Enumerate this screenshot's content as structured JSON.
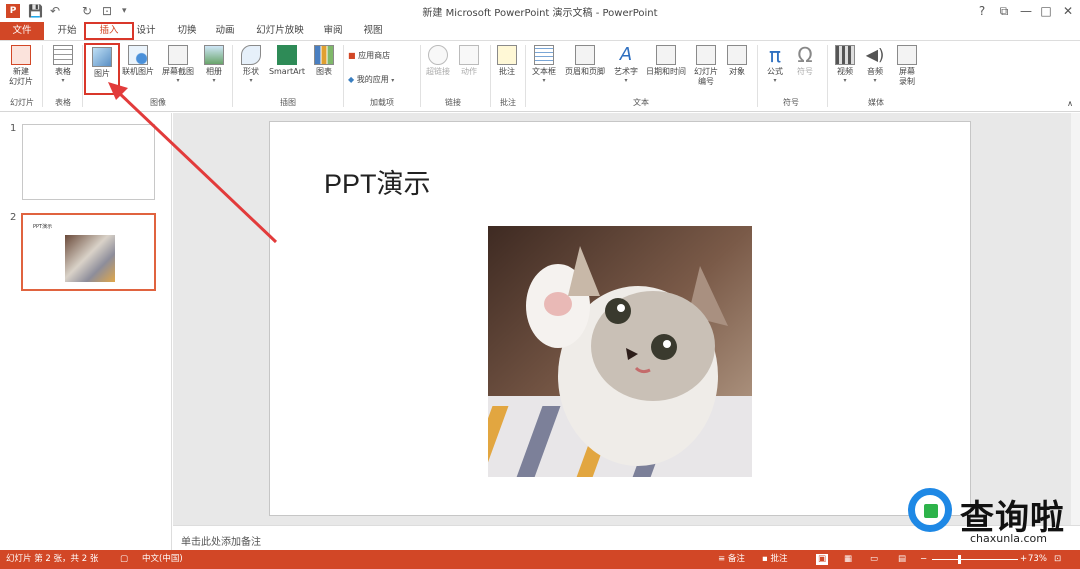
{
  "titlebar": {
    "logo": "P",
    "title": "新建 Microsoft PowerPoint 演示文稿 - PowerPoint",
    "help": "?",
    "restore": "⧉",
    "minimize": "—",
    "maximize": "□",
    "close": "✕"
  },
  "quick_access": {
    "save": "💾",
    "undo": "↶",
    "redo": "↻",
    "start": "⊡",
    "more": "▾"
  },
  "tabs": [
    "文件",
    "开始",
    "插入",
    "设计",
    "切换",
    "动画",
    "幻灯片放映",
    "审阅",
    "视图"
  ],
  "ribbon": {
    "new_slide": "新建\n幻灯片",
    "table": "表格",
    "picture": "图片",
    "online_picture": "联机图片",
    "screenshot": "屏幕截图",
    "album": "相册",
    "shapes": "形状",
    "smartart": "SmartArt",
    "chart": "图表",
    "store": "应用商店",
    "my_apps": "我的应用",
    "hyperlink": "超链接",
    "action": "动作",
    "comment": "批注",
    "textbox": "文本框",
    "header_footer": "页眉和页脚",
    "wordart": "艺术字",
    "datetime": "日期和时间",
    "slide_number": "幻灯片\n编号",
    "object": "对象",
    "equation": "公式",
    "symbol": "符号",
    "video": "视频",
    "audio": "音频",
    "screen_record": "屏幕\n录制",
    "groups": {
      "slides": "幻灯片",
      "tables": "表格",
      "images": "图像",
      "illustrations": "插图",
      "addins": "加载项",
      "links": "链接",
      "comments": "批注",
      "text": "文本",
      "symbols": "符号",
      "media": "媒体"
    }
  },
  "slides": {
    "thumb1_num": "1",
    "thumb2_num": "2",
    "thumb2_title": "PPT演示",
    "main_title": "PPT演示"
  },
  "notes": {
    "placeholder": "单击此处添加备注"
  },
  "status": {
    "slide_info": "幻灯片 第 2 张，共 2 张",
    "lang": "中文(中国)",
    "notes": "备注",
    "comments": "批注",
    "zoom": "73%"
  },
  "watermark": {
    "brand": "查询啦",
    "url": "chaxunla.com"
  },
  "colors": {
    "accent": "#d24726",
    "highlight": "#d9372a",
    "watermark_blue": "#1e88e5",
    "watermark_green": "#2db34a"
  }
}
